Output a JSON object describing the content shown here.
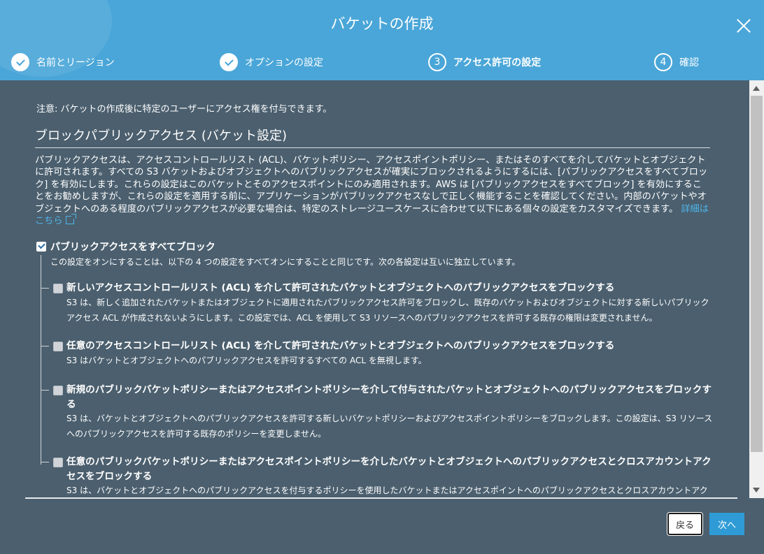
{
  "header": {
    "title": "バケットの作成",
    "close_icon": "close-icon"
  },
  "steps": [
    {
      "label": "名前とリージョン",
      "state": "done"
    },
    {
      "label": "オプションの設定",
      "state": "done"
    },
    {
      "number": "3",
      "label": "アクセス許可の設定",
      "state": "active"
    },
    {
      "number": "4",
      "label": "確認",
      "state": "pending"
    }
  ],
  "content": {
    "note": "注意: バケットの作成後に特定のユーザーにアクセス権を付与できます。",
    "section_title": "ブロックパブリックアクセス (バケット設定)",
    "description": "パブリックアクセスは、アクセスコントロールリスト (ACL)、バケットポリシー、アクセスポイントポリシー、またはそのすべてを介してバケットとオブジェクトに許可されます。すべての S3 バケットおよびオブジェクトへのパブリックアクセスが確実にブロックされるようにするには、[パブリックアクセスをすべてブロック] を有効にします。これらの設定はこのバケットとそのアクセスポイントにのみ適用されます。AWS は [パブリックアクセスをすべてブロック] を有効にすることをお勧めしますが、これらの設定を適用する前に、アプリケーションがパブリックアクセスなしで正しく機能することを確認してください。内部のバケットやオブジェクトへのある程度のパブリックアクセスが必要な場合は、特定のストレージユースケースに合わせて以下にある個々の設定をカスタマイズできます。",
    "learn_more": "詳細はこちら",
    "block_all": {
      "label": "パブリックアクセスをすべてブロック",
      "checked": true,
      "description": "この設定をオンにすることは、以下の 4 つの設定をすべてオンにすることと同じです。次の各設定は互いに独立しています。"
    },
    "options": [
      {
        "title": "新しいアクセスコントロールリスト (ACL) を介して許可されたバケットとオブジェクトへのパブリックアクセスをブロックする",
        "description": "S3 は、新しく追加されたバケットまたはオブジェクトに適用されたパブリックアクセス許可をブロックし、既存のバケットおよびオブジェクトに対する新しいパブリックアクセス ACL が作成されないようにします。この設定では、ACL を使用して S3 リソースへのパブリックアクセスを許可する既存の権限は変更されません。"
      },
      {
        "title": "任意のアクセスコントロールリスト (ACL) を介して許可されたバケットとオブジェクトへのパブリックアクセスをブロックする",
        "description": "S3 はバケットとオブジェクトへのパブリックアクセスを許可するすべての ACL を無視します。"
      },
      {
        "title": "新規のパブリックバケットポリシーまたはアクセスポイントポリシーを介して付与されたバケットとオブジェクトへのパブリックアクセスをブロックする",
        "description": "S3 は、バケットとオブジェクトへのパブリックアクセスを許可する新しいバケットポリシーおよびアクセスポイントポリシーをブロックします。この設定は、S3 リソースへのパブリックアクセスを許可する既存のポリシーを変更しません。"
      },
      {
        "title": "任意のパブリックバケットポリシーまたはアクセスポイントポリシーを介したバケットとオブジェクトへのパブリックアクセスとクロスアカウントアクセスをブロックする",
        "description": "S3 は、バケットとオブジェクトへのパブリックアクセスを付与するポリシーを使用したバケットまたはアクセスポイントへのパブリックアクセスとクロスアカウントアク"
      }
    ]
  },
  "footer": {
    "back_label": "戻る",
    "next_label": "次へ"
  },
  "colors": {
    "header_bg": "#4aa6d8",
    "body_bg": "#4b5f6e",
    "link": "#4fb6ec",
    "primary_button": "#2f9bd6"
  }
}
